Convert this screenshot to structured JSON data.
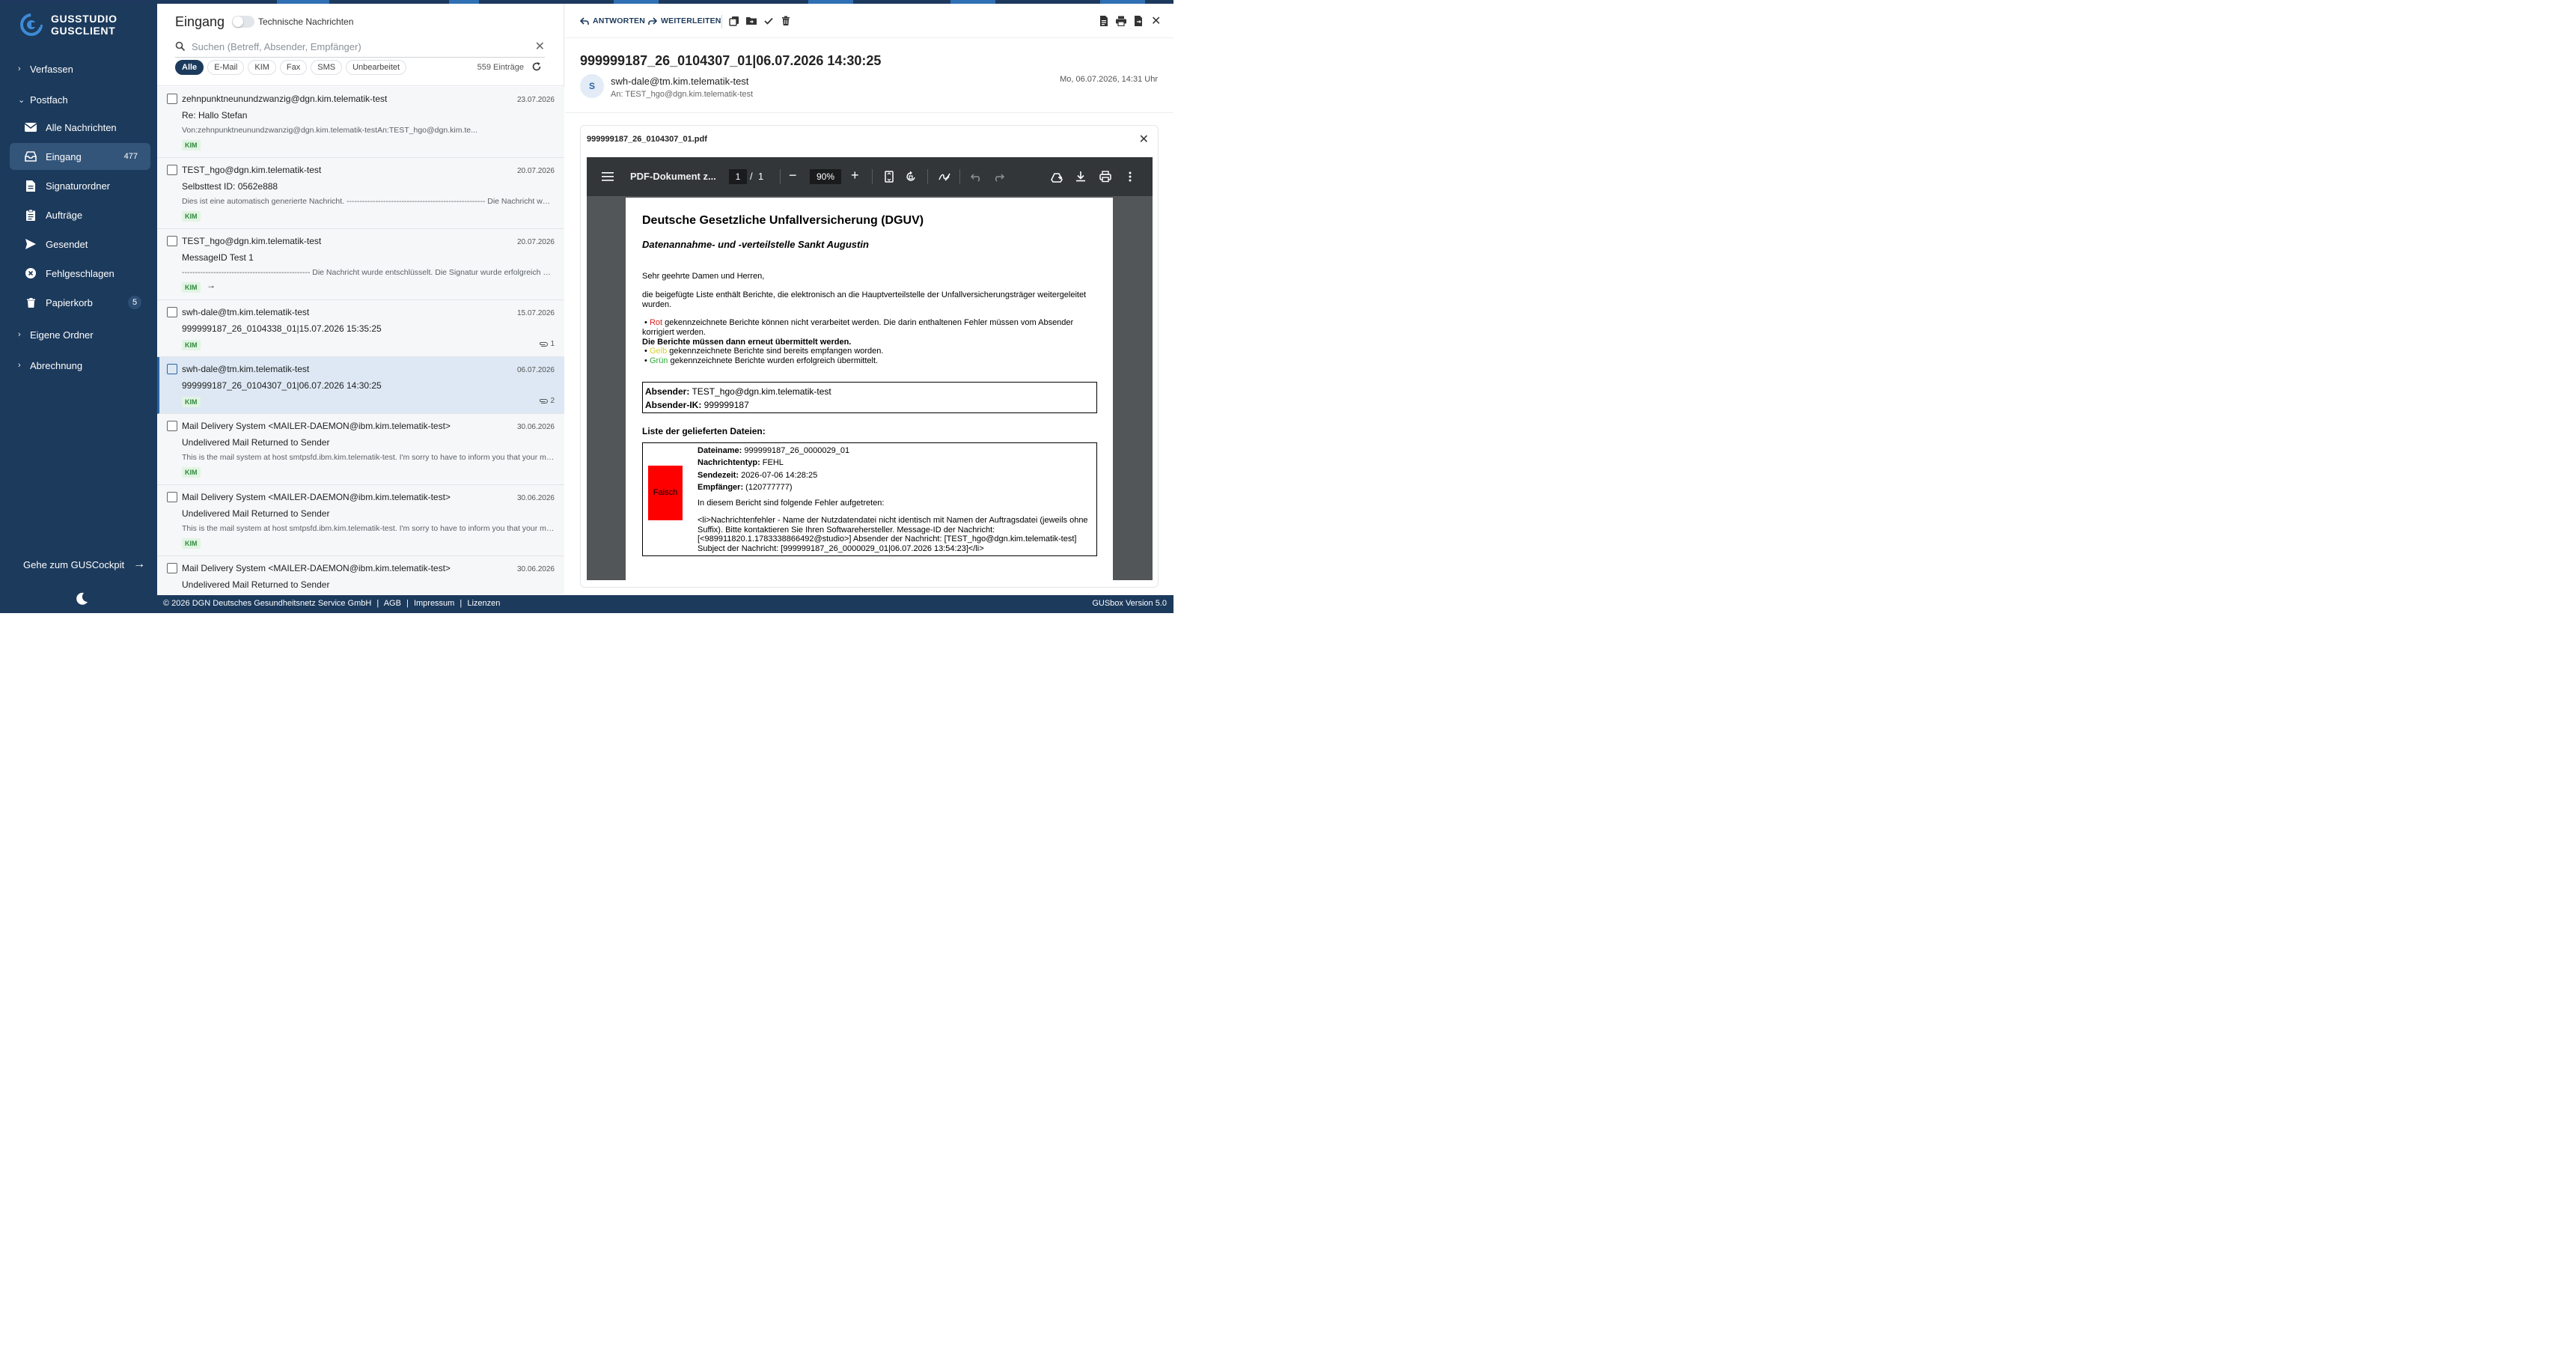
{
  "brand": {
    "line1": "GUSSTUDIO",
    "line2": "GUSCLIENT"
  },
  "sidebar": {
    "sections": {
      "compose": "Verfassen",
      "mailbox": "Postfach",
      "own_folders": "Eigene Ordner",
      "billing": "Abrechnung"
    },
    "items": [
      {
        "label": "Alle Nachrichten",
        "icon": "envelope-icon"
      },
      {
        "label": "Eingang",
        "icon": "inbox-icon",
        "badge": "477"
      },
      {
        "label": "Signaturordner",
        "icon": "document-icon"
      },
      {
        "label": "Aufträge",
        "icon": "clipboard-icon"
      },
      {
        "label": "Gesendet",
        "icon": "send-icon"
      },
      {
        "label": "Fehlgeschlagen",
        "icon": "error-circle-icon"
      },
      {
        "label": "Papierkorb",
        "icon": "trash-icon",
        "badge": "5"
      }
    ],
    "cockpit_label": "Gehe zum GUSCockpit"
  },
  "inbox": {
    "title": "Eingang",
    "toggle_label": "Technische Nachrichten",
    "search_placeholder": "Suchen (Betreff, Absender, Empfänger)",
    "filters": [
      "Alle",
      "E-Mail",
      "KIM",
      "Fax",
      "SMS",
      "Unbearbeitet"
    ],
    "count": "559 Einträge",
    "messages": [
      {
        "from": "zehnpunktneunundzwanzig@dgn.kim.telematik-test",
        "date": "23.07.2026",
        "subject": "Re: Hallo Stefan",
        "preview": "Von:zehnpunktneunundzwanzig@dgn.kim.telematik-testAn:TEST_hgo@dgn.kim.te...",
        "tag": "KIM"
      },
      {
        "from": "TEST_hgo@dgn.kim.telematik-test",
        "date": "20.07.2026",
        "subject": "Selbsttest ID: 0562e888",
        "preview": "Dies ist eine automatisch generierte Nachricht. ----------------------------------------------------- Die Nachricht wurde entschlüsselt...",
        "tag": "KIM"
      },
      {
        "from": "TEST_hgo@dgn.kim.telematik-test",
        "date": "20.07.2026",
        "subject": "MessageID Test 1",
        "preview": "------------------------------------------------- Die Nachricht wurde entschlüsselt. Die Signatur wurde erfolgreich geprüft...",
        "tag": "KIM",
        "tag_arrow": "→"
      },
      {
        "from": "swh-dale@tm.kim.telematik-test",
        "date": "15.07.2026",
        "subject": "999999187_26_0104338_01|15.07.2026 15:35:25",
        "tag": "KIM",
        "attachments": "1"
      },
      {
        "from": "swh-dale@tm.kim.telematik-test",
        "date": "06.07.2026",
        "subject": "999999187_26_0104307_01|06.07.2026 14:30:25",
        "tag": "KIM",
        "attachments": "2"
      },
      {
        "from": "Mail Delivery System <MAILER-DAEMON@ibm.kim.telematik-test>",
        "date": "30.06.2026",
        "subject": "Undelivered Mail Returned to Sender",
        "preview": "This is the mail system at host smtpsfd.ibm.kim.telematik-test. I'm sorry to have to inform you that your message could not be delivered",
        "tag": "KIM"
      },
      {
        "from": "Mail Delivery System <MAILER-DAEMON@ibm.kim.telematik-test>",
        "date": "30.06.2026",
        "subject": "Undelivered Mail Returned to Sender",
        "preview": "This is the mail system at host smtpsfd.ibm.kim.telematik-test. I'm sorry to have to inform you that your message could not be delivered",
        "tag": "KIM"
      },
      {
        "from": "Mail Delivery System <MAILER-DAEMON@ibm.kim.telematik-test>",
        "date": "30.06.2026",
        "subject": "Undelivered Mail Returned to Sender"
      }
    ]
  },
  "reader": {
    "toolbar": {
      "reply": "ANTWORTEN",
      "forward": "WEITERLEITEN"
    },
    "subject": "999999187_26_0104307_01|06.07.2026 14:30:25",
    "avatar": "S",
    "sender": "swh-dale@tm.kim.telematik-test",
    "recipient": "An: TEST_hgo@dgn.kim.telematik-test",
    "date": "Mo, 06.07.2026, 14:31 Uhr",
    "attachment_name": "999999187_26_0104307_01.pdf"
  },
  "pdf": {
    "title": "PDF-Dokument z...",
    "page": "1",
    "slash": "/",
    "total": "1",
    "zoom": "90%",
    "heading": "Deutsche Gesetzliche Unfallversicherung (DGUV)",
    "subheading": "Datenannahme- und -verteilstelle Sankt Augustin",
    "greeting": "Sehr geehrte Damen und Herren,",
    "intro": "die beigefügte Liste enthält Berichte, die elektronisch an die Hauptverteilstelle der Unfallversicherungsträger weitergeleitet wurden.",
    "bullet_red_word": "Rot",
    "bullet_red_text": " gekennzeichnete Berichte können nicht verarbeitet werden. Die darin enthaltenen Fehler müssen vom Absender korrigiert werden.",
    "bold_line": "Die Berichte müssen dann erneut übermittelt werden.",
    "bullet_yellow_word": "Gelb",
    "bullet_yellow_text": " gekennzeichnete Berichte sind bereits empfangen worden.",
    "bullet_green_word": "Grün",
    "bullet_green_text": " gekennzeichnete Berichte wurden erfolgreich übermittelt.",
    "sender_label": "Absender:",
    "sender_value": " TEST_hgo@dgn.kim.telematik-test",
    "sender_ik_label": "Absender-IK:",
    "sender_ik_value": " 999999187",
    "files_heading": "Liste der gelieferten Dateien:",
    "status_label": "Falsch",
    "file": {
      "name_label": "Dateiname:",
      "name": " 999999187_26_0000029_01",
      "type_label": "Nachrichtentyp:",
      "type": " FEHL",
      "time_label": "Sendezeit:",
      "time": " 2026-07-06 14:28:25",
      "recipient_label": "Empfänger:",
      "recipient": "  (120777777)",
      "errors_intro": "In diesem Bericht sind folgende Fehler aufgetreten:",
      "error_text": "<li>Nachrichtenfehler - Name der Nutzdatendatei nicht identisch mit Namen der Auftragsdatei (jeweils ohne Suffix). Bitte kontaktieren Sie Ihren Softwarehersteller.  Message-ID der Nachricht: [<989911820.1.1783338866492@studio>]  Absender der Nachricht: [TEST_hgo@dgn.kim.telematik-test] Subject der Nachricht: [999999187_26_0000029_01|06.07.2026 13:54:23]</li>"
    }
  },
  "footer": {
    "copyright": "© 2026 DGN Deutsches Gesundheitsnetz Service GmbH",
    "sep": "|",
    "agb": "AGB",
    "impressum": "Impressum",
    "licenses": "Lizenzen",
    "version": "GUSbox Version 5.0"
  },
  "colors": {
    "sidebar": "#1c3a5c",
    "accent": "#2a65a3",
    "kim_tag": "#2f8a3c"
  }
}
